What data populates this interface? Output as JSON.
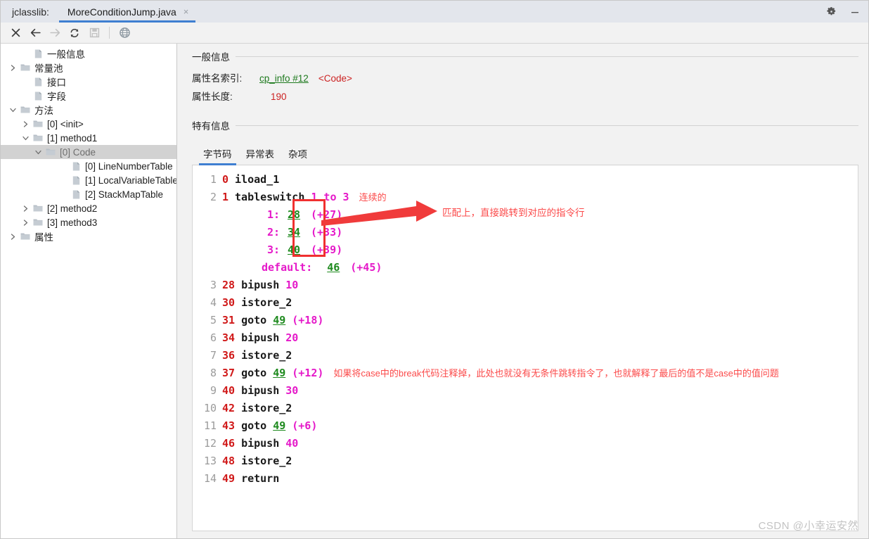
{
  "window": {
    "app_label": "jclasslib:",
    "tab_title": "MoreConditionJump.java",
    "tab_close": "×",
    "settings_icon": "gear-icon",
    "minimize_icon": "minimize-icon"
  },
  "toolbar": {
    "buttons": [
      {
        "name": "close-icon",
        "glyph": "✕",
        "disabled": false
      },
      {
        "name": "back-arrow-icon",
        "glyph": "←",
        "disabled": false
      },
      {
        "name": "forward-arrow-icon",
        "glyph": "→",
        "disabled": true
      },
      {
        "name": "reload-icon",
        "glyph": "⟳",
        "disabled": false
      },
      {
        "name": "save-icon",
        "glyph": "Ὃe",
        "disabled": true
      },
      {
        "name": "browse-icon",
        "glyph": "ἱ0",
        "disabled": false
      }
    ]
  },
  "sidebar": {
    "items": [
      {
        "label": "一般信息",
        "indent": 1,
        "twisty": "none",
        "icon": "file-icon",
        "selected": false
      },
      {
        "label": "常量池",
        "indent": 0,
        "twisty": "collapsed",
        "icon": "folder-icon",
        "selected": false
      },
      {
        "label": "接口",
        "indent": 1,
        "twisty": "none",
        "icon": "file-icon",
        "selected": false
      },
      {
        "label": "字段",
        "indent": 1,
        "twisty": "none",
        "icon": "file-icon",
        "selected": false
      },
      {
        "label": "方法",
        "indent": 0,
        "twisty": "expanded",
        "icon": "folder-icon",
        "selected": false
      },
      {
        "label": "[0] <init>",
        "indent": 1,
        "twisty": "collapsed",
        "icon": "folder-icon",
        "selected": false
      },
      {
        "label": "[1] method1",
        "indent": 1,
        "twisty": "expanded",
        "icon": "folder-icon",
        "selected": false
      },
      {
        "label": "[0] Code",
        "indent": 2,
        "twisty": "expanded",
        "icon": "folder-icon",
        "selected": true
      },
      {
        "label": "[0] LineNumberTable",
        "indent": 4,
        "twisty": "none",
        "icon": "file-icon",
        "selected": false
      },
      {
        "label": "[1] LocalVariableTable",
        "indent": 4,
        "twisty": "none",
        "icon": "file-icon",
        "selected": false
      },
      {
        "label": "[2] StackMapTable",
        "indent": 4,
        "twisty": "none",
        "icon": "file-icon",
        "selected": false
      },
      {
        "label": "[2] method2",
        "indent": 1,
        "twisty": "collapsed",
        "icon": "folder-icon",
        "selected": false
      },
      {
        "label": "[3] method3",
        "indent": 1,
        "twisty": "collapsed",
        "icon": "folder-icon",
        "selected": false
      },
      {
        "label": "属性",
        "indent": 0,
        "twisty": "collapsed",
        "icon": "folder-icon",
        "selected": false
      }
    ]
  },
  "main": {
    "general_section_title": "一般信息",
    "fields": [
      {
        "key": "属性名索引:",
        "link": "cp_info #12",
        "extra": "<Code>",
        "value": ""
      },
      {
        "key": "属性长度:",
        "link": "",
        "extra": "",
        "value": "190"
      }
    ],
    "specific_section_title": "特有信息",
    "tabs": [
      {
        "label": "字节码",
        "active": true
      },
      {
        "label": "异常表",
        "active": false
      },
      {
        "label": "杂项",
        "active": false
      }
    ]
  },
  "bytecode": {
    "lines": [
      {
        "lno": "1",
        "off": "0",
        "mnemonic": "iload_1",
        "operand": "",
        "target": "",
        "delta": "",
        "note": ""
      },
      {
        "lno": "2",
        "off": "1",
        "mnemonic": "tableswitch",
        "operand": "1 to 3",
        "target": "",
        "delta": "",
        "note": "连续的"
      },
      {
        "lno": "3",
        "off": "28",
        "mnemonic": "bipush",
        "operand": "10",
        "target": "",
        "delta": "",
        "note": ""
      },
      {
        "lno": "4",
        "off": "30",
        "mnemonic": "istore_2",
        "operand": "",
        "target": "",
        "delta": "",
        "note": ""
      },
      {
        "lno": "5",
        "off": "31",
        "mnemonic": "goto",
        "operand": "",
        "target": "49",
        "delta": "(+18)",
        "note": ""
      },
      {
        "lno": "6",
        "off": "34",
        "mnemonic": "bipush",
        "operand": "20",
        "target": "",
        "delta": "",
        "note": ""
      },
      {
        "lno": "7",
        "off": "36",
        "mnemonic": "istore_2",
        "operand": "",
        "target": "",
        "delta": "",
        "note": ""
      },
      {
        "lno": "8",
        "off": "37",
        "mnemonic": "goto",
        "operand": "",
        "target": "49",
        "delta": "(+12)",
        "note": "如果将case中的break代码注释掉，此处也就没有无条件跳转指令了，也就解释了最后的值不是case中的值问题"
      },
      {
        "lno": "9",
        "off": "40",
        "mnemonic": "bipush",
        "operand": "30",
        "target": "",
        "delta": "",
        "note": ""
      },
      {
        "lno": "10",
        "off": "42",
        "mnemonic": "istore_2",
        "operand": "",
        "target": "",
        "delta": "",
        "note": ""
      },
      {
        "lno": "11",
        "off": "43",
        "mnemonic": "goto",
        "operand": "",
        "target": "49",
        "delta": "(+6)",
        "note": ""
      },
      {
        "lno": "12",
        "off": "46",
        "mnemonic": "bipush",
        "operand": "40",
        "target": "",
        "delta": "",
        "note": ""
      },
      {
        "lno": "13",
        "off": "48",
        "mnemonic": "istore_2",
        "operand": "",
        "target": "",
        "delta": "",
        "note": ""
      },
      {
        "lno": "14",
        "off": "49",
        "mnemonic": "return",
        "operand": "",
        "target": "",
        "delta": "",
        "note": ""
      }
    ],
    "switch_entries": [
      {
        "case": "1:",
        "target": "28",
        "delta": "(+27)"
      },
      {
        "case": "2:",
        "target": "34",
        "delta": "(+33)"
      },
      {
        "case": "3:",
        "target": "40",
        "delta": "(+39)"
      }
    ],
    "switch_default": {
      "label": "default:",
      "target": "46",
      "delta": "(+45)"
    }
  },
  "annotations": {
    "arrow_note": "匹配上，直接跳转到对应的指令行"
  },
  "watermark": "CSDN @小幸运安然",
  "colors": {
    "accent": "#3f7fd1",
    "offset": "#d01919",
    "mnemonic": "#1a1a1a",
    "operand": "#e519c9",
    "target": "#1e8a1e",
    "annotation": "#fb4b4b",
    "selection": "#d2d2d2"
  }
}
